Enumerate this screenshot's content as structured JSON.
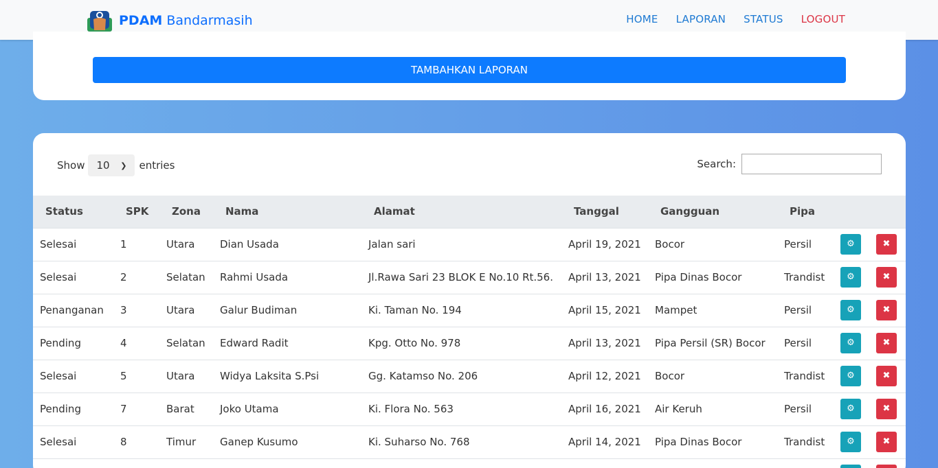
{
  "nav": {
    "brand_bold": "PDAM",
    "brand_rest": " Bandarmasih",
    "links": [
      "HOME",
      "LAPORAN",
      "STATUS",
      "LOGOUT"
    ]
  },
  "top": {
    "add_button": "TAMBAHKAN LAPORAN"
  },
  "table_controls": {
    "show_label": "Show",
    "entries_value": "10",
    "entries_label": "entries",
    "search_label": "Search:"
  },
  "columns": [
    "Status",
    "SPK",
    "Zona",
    "Nama",
    "Alamat",
    "Tanggal",
    "Gangguan",
    "Pipa"
  ],
  "rows": [
    [
      "Selesai",
      "1",
      "Utara",
      "Dian Usada",
      "Jalan sari",
      "April 19, 2021",
      "Bocor",
      "Persil"
    ],
    [
      "Selesai",
      "2",
      "Selatan",
      "Rahmi Usada",
      "Jl.Rawa Sari 23 BLOK E No.10 Rt.56.",
      "April 13, 2021",
      "Pipa Dinas Bocor",
      "Trandist"
    ],
    [
      "Penanganan",
      "3",
      "Utara",
      "Galur Budiman",
      "Ki. Taman No. 194",
      "April 15, 2021",
      "Mampet",
      "Persil"
    ],
    [
      "Pending",
      "4",
      "Selatan",
      "Edward Radit",
      "Kpg. Otto No. 978",
      "April 13, 2021",
      "Pipa Persil (SR) Bocor",
      "Persil"
    ],
    [
      "Selesai",
      "5",
      "Utara",
      "Widya Laksita S.Psi",
      "Gg. Katamso No. 206",
      "April 12, 2021",
      "Bocor",
      "Trandist"
    ],
    [
      "Pending",
      "7",
      "Barat",
      "Joko Utama",
      "Ki. Flora No. 563",
      "April 16, 2021",
      "Air Keruh",
      "Persil"
    ],
    [
      "Selesai",
      "8",
      "Timur",
      "Ganep Kusumo",
      "Ki. Suharso No. 768",
      "April 14, 2021",
      "Pipa Dinas Bocor",
      "Trandist"
    ],
    [
      "",
      "",
      "",
      "",
      "",
      "",
      "",
      ""
    ]
  ],
  "icons": {
    "edit": "gear-icon",
    "delete": "close-icon"
  },
  "colors": {
    "primary": "#0d7bff",
    "edit": "#17a2b8",
    "delete": "#dc3545",
    "logout": "#dc3545"
  }
}
